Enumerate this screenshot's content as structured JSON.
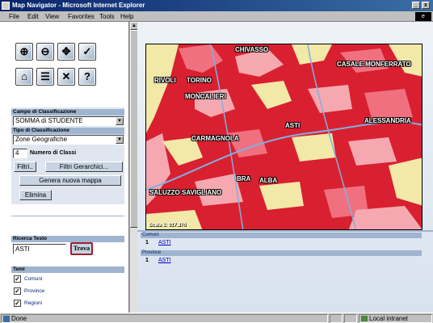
{
  "window": {
    "title": "Map Navigator - Microsoft Internet Explorer"
  },
  "menu": [
    "File",
    "Edit",
    "View",
    "Favorites",
    "Tools",
    "Help"
  ],
  "toolbar": {
    "row1": [
      {
        "name": "zoom-in-icon",
        "glyph": "⊕"
      },
      {
        "name": "zoom-out-icon",
        "glyph": "⊖"
      },
      {
        "name": "pan-icon",
        "glyph": "✥"
      },
      {
        "name": "info-icon",
        "glyph": "✓"
      }
    ],
    "row2": [
      {
        "name": "home-icon",
        "glyph": "⌂"
      },
      {
        "name": "legend-icon",
        "glyph": "☰"
      },
      {
        "name": "clear-icon",
        "glyph": "✕"
      },
      {
        "name": "help-icon",
        "glyph": "?"
      }
    ]
  },
  "classification": {
    "field_label": "Campo di Classificazione",
    "field_value": "SOMMA di STUDENTE",
    "type_label": "Tipo di Classificazione",
    "type_value": "Zone Geografiche",
    "classes_value": "4",
    "classes_label": "Numero di Classi",
    "filter_button": "Filtri..",
    "hier_filter_button": "Filtri Gerarchici...",
    "generate_button": "Genera nuova mappa",
    "delete_button": "Elimina"
  },
  "search": {
    "label": "Ricerca Testo",
    "value": "ASTI",
    "button": "Trova"
  },
  "themes": {
    "label": "Temi",
    "items": [
      "Comuni",
      "Province",
      "Regioni"
    ]
  },
  "map": {
    "labels": [
      "CHIVASSO",
      "CASALE MONFERRATO",
      "RIVOLI",
      "TORINO",
      "MONCALIERI",
      "ASTI",
      "ALESSANDRIA",
      "CARMAGNOLA",
      "BRA",
      "ALBA",
      "SALUZZO",
      "SAVIGLIANO"
    ],
    "scale": "Scala 1: 917.376",
    "colors": {
      "high": "#d92030",
      "mid": "#f07080",
      "low": "#f6a8b0",
      "none": "#f2e8a8",
      "river": "#7fb0e0"
    }
  },
  "results": [
    {
      "header": "Comuni",
      "num": "1",
      "link": "ASTI"
    },
    {
      "header": "Province",
      "num": "1",
      "link": "ASTI"
    }
  ],
  "status": {
    "text": "Done",
    "zone": "Local intranet"
  }
}
